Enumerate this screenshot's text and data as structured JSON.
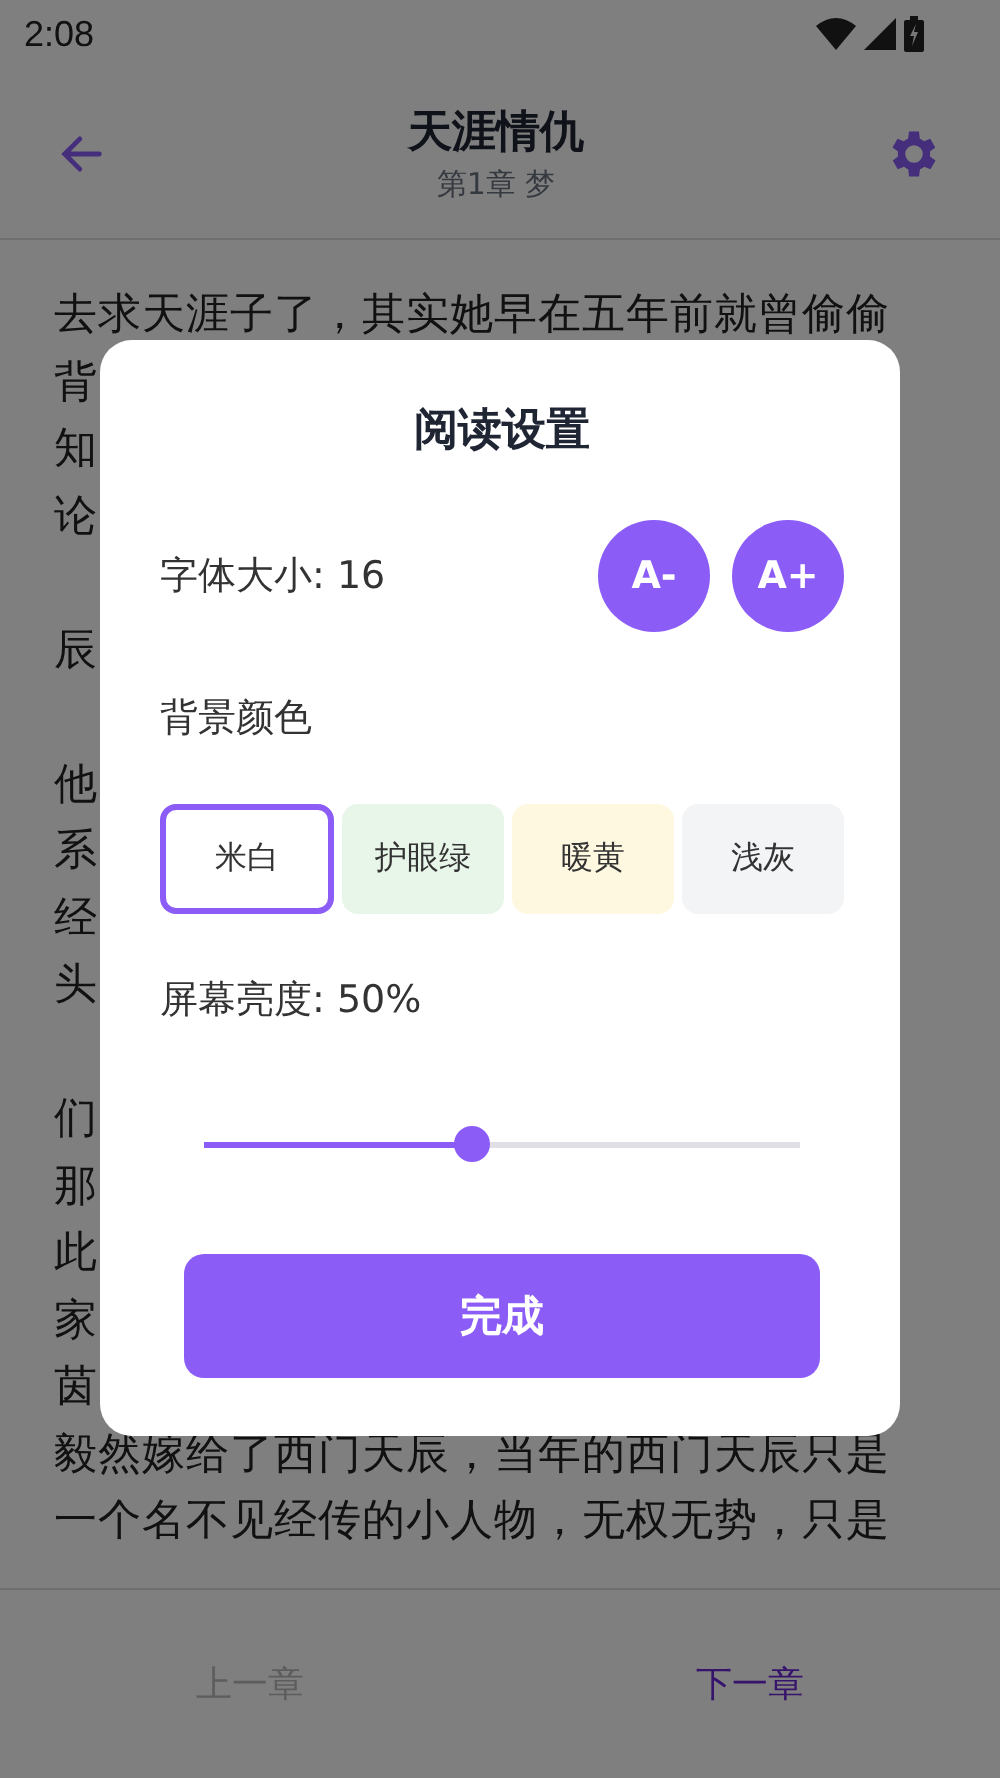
{
  "status_bar": {
    "time": "2:08"
  },
  "header": {
    "title": "天涯情仇",
    "subtitle": "第1章 梦"
  },
  "reader_lines": [
    {
      "text": "去求天涯子了，其实她早在五年前就曾偷偷",
      "gap_before": false
    },
    {
      "text": "背",
      "gap_before": false
    },
    {
      "text": "知",
      "gap_before": false
    },
    {
      "text": "论",
      "gap_before": false
    },
    {
      "text": "辰",
      "gap_before": true
    },
    {
      "text": "他",
      "gap_before": true
    },
    {
      "text": "系",
      "gap_before": false
    },
    {
      "text": "经",
      "gap_before": false
    },
    {
      "text": "头",
      "gap_before": false
    },
    {
      "text": "们",
      "gap_before": true
    },
    {
      "text": "那",
      "gap_before": false
    },
    {
      "text": "此",
      "gap_before": false
    },
    {
      "text": "家",
      "gap_before": false
    },
    {
      "text": "茵",
      "gap_before": false
    },
    {
      "text": "毅然嫁给了西门天辰，当年的西门天辰只是",
      "gap_before": false
    },
    {
      "text": "一个名不见经传的小人物，无权无势，只是",
      "gap_before": false
    }
  ],
  "chapter_nav": [
    {
      "label": "上一章",
      "disabled": true
    },
    {
      "label": "下一章",
      "disabled": false
    }
  ],
  "dialog": {
    "title": "阅读设置",
    "font_size_label": "字体大小: 16",
    "font_buttons": [
      "A-",
      "A+"
    ],
    "background_label": "背景颜色",
    "backgrounds": [
      {
        "label": "米白",
        "color": "#ffffff",
        "selected": true
      },
      {
        "label": "护眼绿",
        "color": "#e8f5e9",
        "selected": false
      },
      {
        "label": "暖黄",
        "color": "#fff8e1",
        "selected": false
      },
      {
        "label": "浅灰",
        "color": "#f3f4f6",
        "selected": false
      }
    ],
    "brightness_label": "屏幕亮度: 50%",
    "brightness": {
      "level": 0.45
    },
    "done_button": "完成"
  }
}
